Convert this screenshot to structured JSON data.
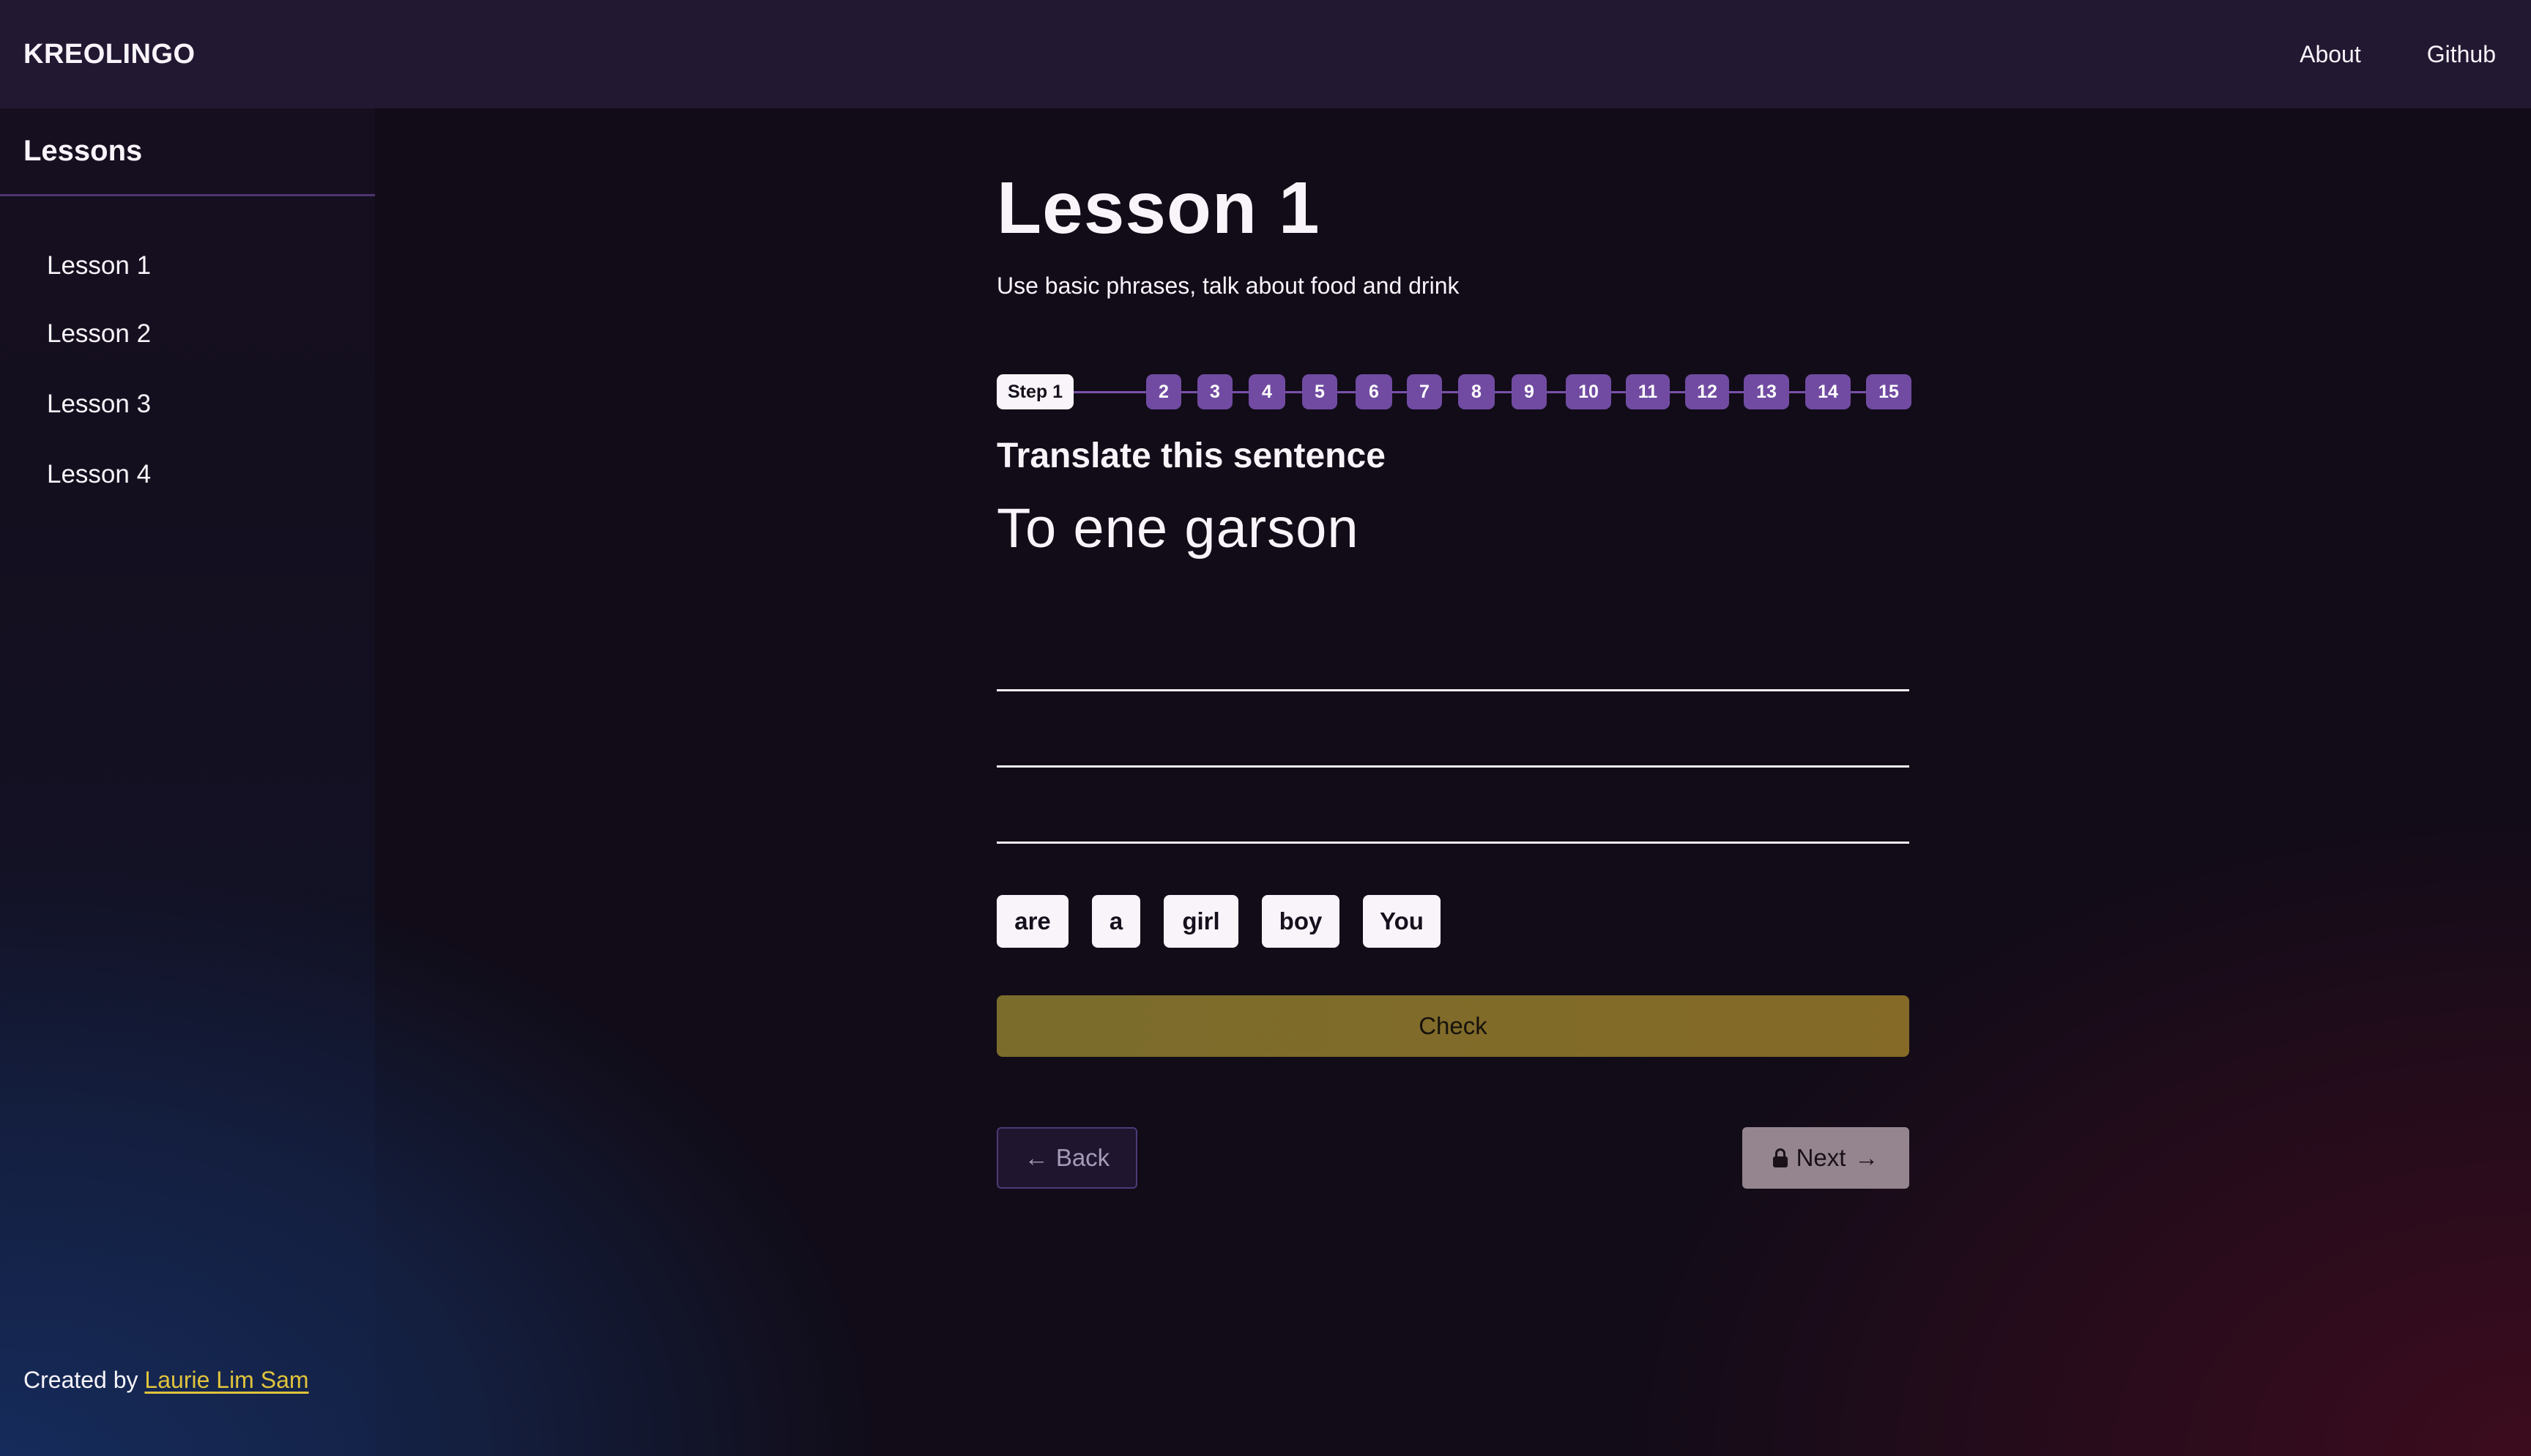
{
  "app": {
    "brand": "KREOLINGO",
    "nav": [
      {
        "label": "About"
      },
      {
        "label": "Github"
      }
    ]
  },
  "sidebar": {
    "title": "Lessons",
    "items": [
      {
        "label": "Lesson 1"
      },
      {
        "label": "Lesson 2"
      },
      {
        "label": "Lesson 3"
      },
      {
        "label": "Lesson 4"
      }
    ],
    "footer": {
      "prefix": "Created by",
      "author_link": "Laurie Lim Sam"
    }
  },
  "lesson": {
    "title": "Lesson 1",
    "subtitle": "Use basic phrases, talk about food and drink",
    "stepper": {
      "current_label": "Step 1",
      "current_step": 1,
      "total_steps": 15,
      "steps": [
        "2",
        "3",
        "4",
        "5",
        "6",
        "7",
        "8",
        "9",
        "10",
        "11",
        "12",
        "13",
        "14",
        "15"
      ]
    },
    "task": {
      "instruction": "Translate this sentence",
      "sentence": "To ene garson",
      "answer_lines": 3,
      "word_bank": [
        "are",
        "a",
        "girl",
        "boy",
        "You"
      ]
    },
    "buttons": {
      "check": "Check",
      "back": "Back",
      "next": "Next",
      "back_arrow": "←",
      "next_arrow": "→"
    }
  },
  "colors": {
    "header_bg": "#231832",
    "step_accent": "#714ba2",
    "check_bg": "#7f6b2a",
    "link": "#e0c43c"
  }
}
